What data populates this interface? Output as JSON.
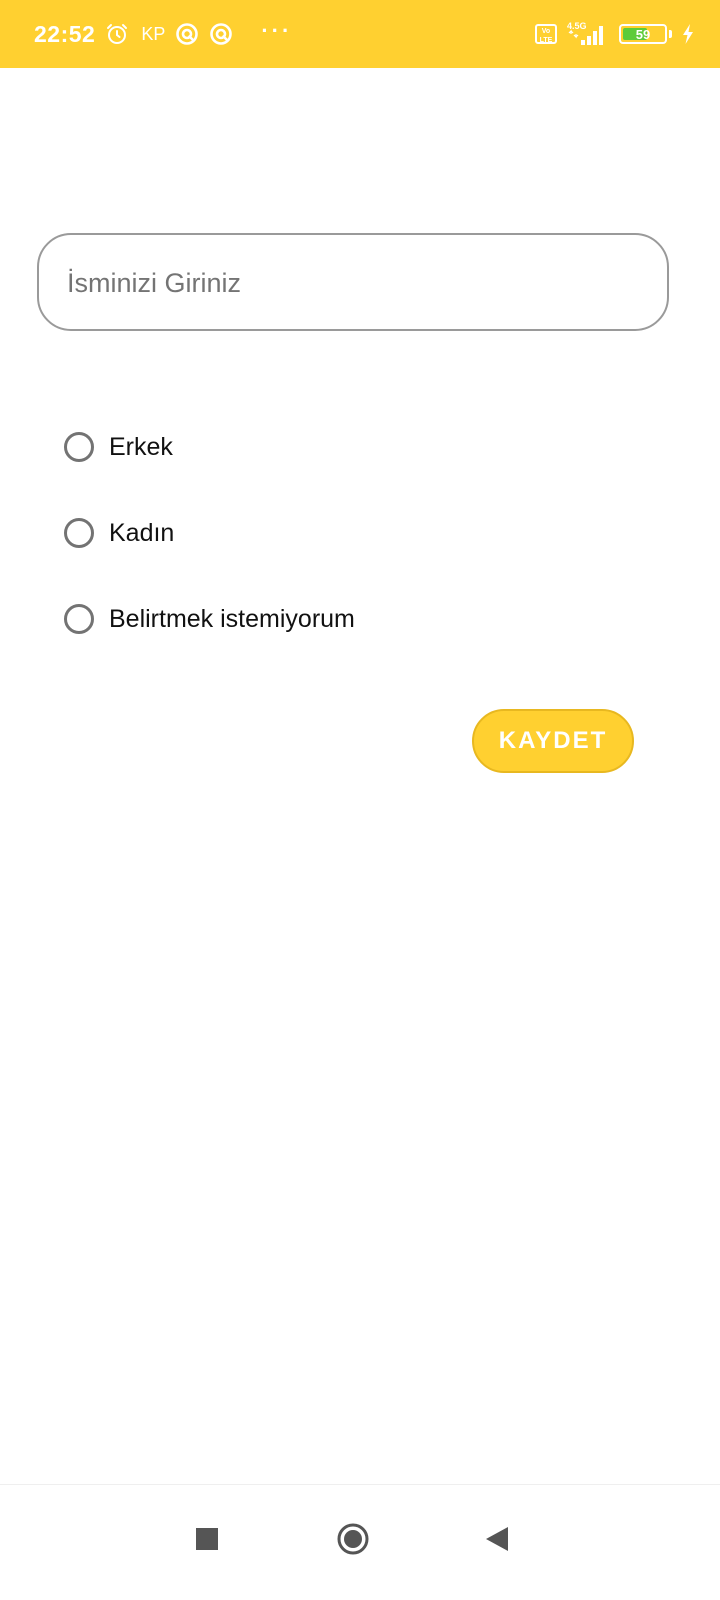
{
  "status_bar": {
    "time": "22:52",
    "carrier": "KP",
    "more": "···",
    "volte": "Vo LTE",
    "network": "4.5G",
    "battery_level": "59",
    "battery_fraction": 0.59,
    "background_color": "#FFD030",
    "icons": [
      "alarm-icon",
      "app-notification-icon",
      "app-notification-icon",
      "volte-icon",
      "signal-icon",
      "battery-icon",
      "charging-icon"
    ]
  },
  "form": {
    "name_placeholder": "İsminizi Giriniz",
    "name_value": "",
    "gender_options": [
      {
        "label": "Erkek",
        "selected": false
      },
      {
        "label": "Kadın",
        "selected": false
      },
      {
        "label": "Belirtmek istemiyorum",
        "selected": false
      }
    ],
    "save_label": "KAYDET",
    "accent_color": "#FFD030"
  },
  "nav_bar": {
    "icons": [
      "recents-square-icon",
      "home-circle-icon",
      "back-triangle-icon"
    ]
  }
}
